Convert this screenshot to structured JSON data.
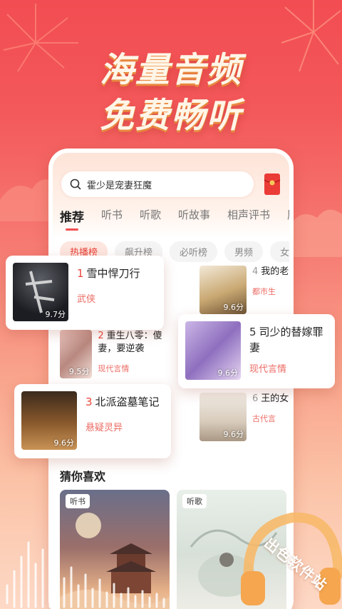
{
  "promo": {
    "headline_1": "海量音频",
    "headline_2": "免费畅听"
  },
  "search": {
    "icon": "search-icon",
    "query": "霍少是宠妻狂魔"
  },
  "tabs": [
    {
      "label": "推荐",
      "active": true
    },
    {
      "label": "听书",
      "active": false
    },
    {
      "label": "听歌",
      "active": false
    },
    {
      "label": "听故事",
      "active": false
    },
    {
      "label": "相声评书",
      "active": false
    },
    {
      "label": "历",
      "active": false
    }
  ],
  "chips": [
    {
      "label": "热播榜",
      "active": true
    },
    {
      "label": "飙升榜",
      "active": false
    },
    {
      "label": "必听榜",
      "active": false
    },
    {
      "label": "男频",
      "active": false
    },
    {
      "label": "女",
      "active": false
    }
  ],
  "ranking": [
    {
      "rank": "1",
      "title": "雪中悍刀行",
      "tag": "武侠",
      "score": "9.7分"
    },
    {
      "rank": "2",
      "title": "重生八零：傻妻，要逆袭",
      "tag": "现代言情",
      "score": "9.5分"
    },
    {
      "rank": "3",
      "title": "北派盗墓笔记",
      "tag": "悬疑灵异",
      "score": "9.6分"
    },
    {
      "rank": "4",
      "title": "我的老",
      "tag": "都市生",
      "score": "9.6分"
    },
    {
      "rank": "5",
      "title": "司少的替嫁罪妻",
      "tag": "现代言情",
      "score": "9.6分"
    },
    {
      "rank": "6",
      "title": "王的女",
      "tag": "古代言",
      "score": "9.6分"
    }
  ],
  "recommend": {
    "title": "猜你喜欢",
    "cards": [
      {
        "label": "听书"
      },
      {
        "label": "听歌"
      }
    ]
  },
  "watermark": "出色软件站",
  "colors": {
    "accent": "#e8453c",
    "background_top": "#f24d52",
    "background_bottom": "#fdd9c6"
  }
}
